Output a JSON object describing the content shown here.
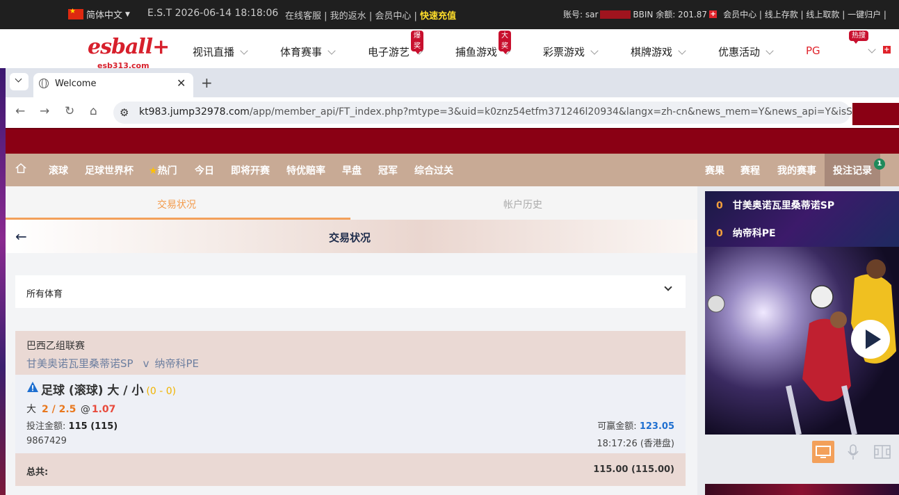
{
  "topbar": {
    "language": "简体中文",
    "time": "E.S.T 2026-06-14 18:18:06",
    "links": [
      "在线客服",
      "我的返水",
      "会员中心"
    ],
    "recharge": "快速充值",
    "account_label": "账号: sar",
    "balance_label": "BBIN 余额: 201.87",
    "right_links": "会员中心 | 线上存款 | 线上取款 | 一键归户 |"
  },
  "logo": {
    "brand": "esball+",
    "domain": "esb313.com"
  },
  "mainnav": {
    "items": [
      {
        "label": "视讯直播"
      },
      {
        "label": "体育赛事"
      },
      {
        "label": "电子游艺",
        "badge": "爆奖"
      },
      {
        "label": "捕鱼游戏",
        "badge": "大奖"
      },
      {
        "label": "彩票游戏"
      },
      {
        "label": "棋牌游戏"
      },
      {
        "label": "优惠活动"
      },
      {
        "label": "PG"
      }
    ],
    "hot_badge": "热搜"
  },
  "browser": {
    "tab_title": "Welcome",
    "url_domain": "kt983.jump32978.com",
    "url_path": "/app/member_api/FT_index.php?mtype=3&uid=k0znz54etfm371246l20934&langx=zh-cn&news_mem=Y&news_api=Y&isSSL=Y"
  },
  "sitenav": {
    "left": [
      "滚球",
      "足球世界杯",
      "热门",
      "今日",
      "即将开赛",
      "特优赔率",
      "早盘",
      "冠军",
      "综合过关"
    ],
    "right": [
      "赛果",
      "赛程",
      "我的赛事",
      "投注记录"
    ],
    "notif_count": "1"
  },
  "content": {
    "tab_active": "交易状况",
    "tab_inactive": "帐户历史",
    "page_title": "交易状况",
    "filter": "所有体育",
    "bet": {
      "league": "巴西乙组联赛",
      "home": "甘美奥诺瓦里桑蒂诺SP",
      "vs": "v",
      "away": "纳帝科PE",
      "type": "足球 (滚球) 大 / 小",
      "score": "(0 - 0)",
      "selection": "大",
      "line": "2 / 2.5",
      "at": "@",
      "odds": "1.07",
      "stake_label": "投注金额:",
      "stake_value": "115 (115)",
      "win_label": "可赢金额:",
      "win_value": "123.05",
      "ticket": "9867429",
      "time": "18:17:26 (香港盘)"
    },
    "total_label": "总共:",
    "total_value": "115.00 (115.00)"
  },
  "rpanel": {
    "scores": [
      {
        "score": "0",
        "team": "甘美奥诺瓦里桑蒂诺SP"
      },
      {
        "score": "0",
        "team": "纳帝科PE"
      }
    ]
  }
}
